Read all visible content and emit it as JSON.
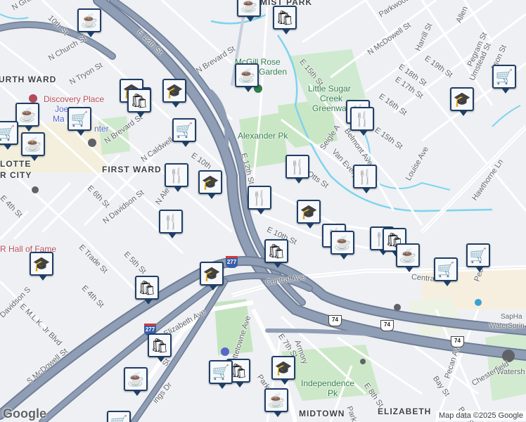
{
  "map": {
    "attribution": "Map data ©2025 Google",
    "logo": "Google",
    "colors": {
      "highway": "#8f9eb4",
      "highway_edge": "#6f7e96",
      "park": "#c9e7c4",
      "water": "#7fd3ee",
      "shield_blue": "#3a5ea8",
      "pin_border": "#1f3e66"
    }
  },
  "labels": {
    "area_fourth_ward": "URTH WARD",
    "area_first_ward": "FIRST WARD",
    "area_uptown": "LOTTE",
    "area_uptown2": "R CITY",
    "area_midtown": "MIDTOWN",
    "area_elizabeth": "ELIZABETH",
    "area_mist_park": "MIST PARK",
    "park_mcgill": "McGill Rose",
    "park_mcgill2": "Garden",
    "park_little_sugar": "Little Sugar",
    "park_creek": "Creek",
    "park_greenway": "Greenwa",
    "park_alexander": "Alexander Pk",
    "park_independence": "Independence",
    "park_independence2": "Pk",
    "poi_discovery": "Discovery Place",
    "poi_hall": "R Hall of Fame",
    "poi_joe": "Joe",
    "poi_ma": "Ma",
    "poi_nter": "nter",
    "poi_sapha": "SapHa",
    "poi_waterspr": "WaterSprin",
    "poi_watersh": "Watersh"
  },
  "streets": {
    "n_graham": "N Grah",
    "w10th": "10th St",
    "n_church": "N Church St",
    "n_tryon": "N Tryon St",
    "e12th_top": "E 12th St",
    "n_brevard_top": "N Brevard St",
    "n_brevard_mid": "N Brevard St",
    "n_caldwell": "N Caldwell",
    "e10th_a": "E 10th",
    "n_davidson": "N Davidson St",
    "e6th": "E 6th St",
    "e4th": "E 4th St",
    "n_ale": "N Ale",
    "e12th_mid": "E 12th St",
    "e15th": "E 15th St",
    "e16th": "E 16th St",
    "e17th": "E 17th St",
    "e18th": "E 18th St",
    "e19th": "E 19th St",
    "e15th_b": "E 15th St",
    "parkwood": "Parkwood Ave",
    "n_mcdowell": "N McDowell St",
    "harrill": "Harrill St",
    "allen": "Allen",
    "pegram": "Pegram St",
    "umstead": "Umstead St",
    "jackson": "kson St",
    "seigle": "Seigle A",
    "belmont": "Belmont Ave",
    "van_every": "Van Every",
    "otts": "Otts St",
    "louise": "Louise Ave",
    "hawthorne": "Hawthorne Ln",
    "e10th_b": "E 10th St",
    "central": "Central Ave",
    "centra2": "Centra",
    "e_trade": "E Trade St",
    "e5th": "E 5th St",
    "e4th_b": "E 4th St",
    "s_davidson": "Davidson S",
    "e_mlk": "E M.L.K. Jr Blvd",
    "s_mcdowell": "S McDowell St",
    "elizabeth_ave": "Elizabeth Ave",
    "e7th": "E 7th St",
    "charlottetowne": "Charlottetowne Ave",
    "armory": "Armory",
    "park_dr": "Park Dr",
    "park_dr2": "Park Dr",
    "e8th": "E 8th St",
    "bay_st": "Bay St",
    "bay_st2": "Bay St",
    "pecan": "Pecan Ave",
    "chesterfield": "Chesterfield",
    "pec": "Pec",
    "kings": "ings Dr",
    "st_241": "St",
    "e4th_c": "E 4th St"
  },
  "shields": {
    "i277_a": "277",
    "i277_b": "277",
    "us74_a": "74",
    "us74_b": "74",
    "us74_c": "74"
  },
  "markers": [
    {
      "icon": "cafe-icon",
      "glyph": "☕"
    },
    {
      "icon": "shopping-bag-icon",
      "glyph": "🛍"
    },
    {
      "icon": "cafe-icon",
      "glyph": "☕"
    },
    {
      "icon": "shopping-bag-icon",
      "glyph": "🛍"
    },
    {
      "icon": "school-icon",
      "glyph": "🎓"
    },
    {
      "icon": "school-icon",
      "glyph": "🎓"
    },
    {
      "icon": "shopping-bag-icon",
      "glyph": "🛍"
    },
    {
      "icon": "cafe-icon",
      "glyph": "☕"
    },
    {
      "icon": "cafe-icon",
      "glyph": "☕"
    },
    {
      "icon": "grocery-cart-icon",
      "glyph": "🛒"
    },
    {
      "icon": "grocery-cart-icon",
      "glyph": "🛒"
    },
    {
      "icon": "cafe-icon",
      "glyph": "☕"
    },
    {
      "icon": "school-icon",
      "glyph": "🎓"
    },
    {
      "icon": "grocery-cart-icon",
      "glyph": "🛒"
    },
    {
      "icon": "restaurant-icon",
      "glyph": "🍴"
    },
    {
      "icon": "restaurant-icon",
      "glyph": "🍴"
    },
    {
      "icon": "school-icon",
      "glyph": "🎓"
    },
    {
      "icon": "restaurant-icon",
      "glyph": "🍴"
    },
    {
      "icon": "restaurant-icon",
      "glyph": "🍴"
    },
    {
      "icon": "restaurant-icon",
      "glyph": "🍴"
    },
    {
      "icon": "school-icon",
      "glyph": "🎓"
    },
    {
      "icon": "restaurant-icon",
      "glyph": "🍴"
    },
    {
      "icon": "restaurant-icon",
      "glyph": "🍴"
    },
    {
      "icon": "restaurant-icon",
      "glyph": "🍴"
    },
    {
      "icon": "cafe-icon",
      "glyph": "☕"
    },
    {
      "icon": "restaurant-icon",
      "glyph": "🍴"
    },
    {
      "icon": "shopping-bag-icon",
      "glyph": "🛍"
    },
    {
      "icon": "shopping-bag-icon",
      "glyph": "🛍"
    },
    {
      "icon": "shopping-bag-icon",
      "glyph": "🛍"
    },
    {
      "icon": "cafe-icon",
      "glyph": "☕"
    },
    {
      "icon": "grocery-cart-icon",
      "glyph": "🛒"
    },
    {
      "icon": "grocery-cart-icon",
      "glyph": "🛒"
    },
    {
      "icon": "school-icon",
      "glyph": "🎓"
    },
    {
      "icon": "school-icon",
      "glyph": "🎓"
    },
    {
      "icon": "shopping-bag-icon",
      "glyph": "🛍"
    },
    {
      "icon": "shopping-bag-icon",
      "glyph": "🛍"
    },
    {
      "icon": "grocery-cart-icon",
      "glyph": "🛒"
    },
    {
      "icon": "school-icon",
      "glyph": "🎓"
    },
    {
      "icon": "school-icon",
      "glyph": "🎓"
    },
    {
      "icon": "cafe-icon",
      "glyph": "☕"
    },
    {
      "icon": "cafe-icon",
      "glyph": "☕"
    },
    {
      "icon": "grocery-cart-icon",
      "glyph": "🛒"
    }
  ]
}
